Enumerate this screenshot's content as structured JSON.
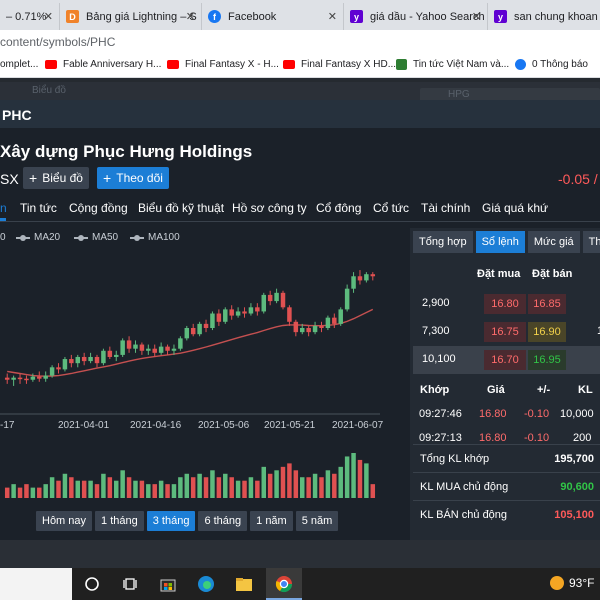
{
  "browser": {
    "tabs": [
      {
        "title": "– 0.71%",
        "icon": "page-icon",
        "color": "#e8eaed"
      },
      {
        "title": "Bảng giá Lightning – S",
        "icon": "vndirect-icon",
        "color": "#f0822a"
      },
      {
        "title": "Facebook",
        "icon": "facebook-icon",
        "color": "#1877f2"
      },
      {
        "title": "giá dầu - Yahoo Search",
        "icon": "yahoo-icon",
        "color": "#6001d2"
      },
      {
        "title": "san chung khoan vn",
        "icon": "yahoo-icon",
        "color": "#6001d2"
      }
    ],
    "url": "content/symbols/PHC",
    "bookmarks": [
      {
        "label": "omplet...",
        "icon": "youtube-icon",
        "color": "#ff0000"
      },
      {
        "label": "Fable Anniversary H...",
        "icon": "youtube-icon",
        "color": "#ff0000"
      },
      {
        "label": "Final Fantasy X - H...",
        "icon": "youtube-icon",
        "color": "#ff0000"
      },
      {
        "label": "Final Fantasy X HD...",
        "icon": "youtube-icon",
        "color": "#ff0000"
      },
      {
        "label": "Tin tức Việt Nam và...",
        "icon": "news-icon",
        "color": "#2e7d32"
      },
      {
        "label": "0 Thông báo",
        "icon": "facebook-icon",
        "color": "#1877f2"
      }
    ]
  },
  "background": {
    "nav_hint": "Biểu đồ",
    "search_hint": "HPG"
  },
  "modal": {
    "ticker": "PHC",
    "company": "Xây dựng Phục Hưng Holdings",
    "exchange": "SX",
    "chart_button": "Biểu đồ",
    "follow_button": "Theo dõi",
    "change": "-0.05 /",
    "tabs": [
      "n",
      "Tin tức",
      "Cộng đồng",
      "Biểu đồ kỹ thuật",
      "Hồ sơ công ty",
      "Cổ đông",
      "Cổ tức",
      "Tài chính",
      "Giá quá khứ"
    ],
    "legend": [
      "0",
      "MA20",
      "MA50",
      "MA100"
    ],
    "ranges": [
      "Hôm nay",
      "1 tháng",
      "3 tháng",
      "6 tháng",
      "1 năm",
      "5 năm"
    ],
    "active_range": "3 tháng"
  },
  "chart_data": {
    "type": "candlestick",
    "x_ticks": [
      "-17",
      "2021-04-01",
      "2021-04-16",
      "2021-05-06",
      "2021-05-21",
      "2021-06-07"
    ],
    "series": [
      {
        "name": "MA20",
        "type": "line",
        "color": "#c45050"
      },
      {
        "name": "volume",
        "type": "bar"
      }
    ],
    "up_color": "#5dbb7e",
    "down_color": "#e05151",
    "candles": [
      {
        "o": 11.9,
        "c": 11.8,
        "h": 12.1,
        "l": 11.6,
        "v": 3
      },
      {
        "o": 11.8,
        "c": 11.9,
        "h": 12.0,
        "l": 11.5,
        "v": 4
      },
      {
        "o": 11.9,
        "c": 11.85,
        "h": 12.1,
        "l": 11.6,
        "v": 3
      },
      {
        "o": 11.85,
        "c": 11.8,
        "h": 12.0,
        "l": 11.6,
        "v": 4
      },
      {
        "o": 11.8,
        "c": 11.95,
        "h": 12.1,
        "l": 11.7,
        "v": 3
      },
      {
        "o": 11.95,
        "c": 11.85,
        "h": 12.2,
        "l": 11.7,
        "v": 3
      },
      {
        "o": 11.85,
        "c": 12.0,
        "h": 12.2,
        "l": 11.7,
        "v": 4
      },
      {
        "o": 12.0,
        "c": 12.4,
        "h": 12.5,
        "l": 11.9,
        "v": 6
      },
      {
        "o": 12.4,
        "c": 12.3,
        "h": 12.6,
        "l": 12.1,
        "v": 5
      },
      {
        "o": 12.3,
        "c": 12.8,
        "h": 12.9,
        "l": 12.2,
        "v": 7
      },
      {
        "o": 12.8,
        "c": 12.6,
        "h": 13.0,
        "l": 12.4,
        "v": 6
      },
      {
        "o": 12.6,
        "c": 12.9,
        "h": 13.0,
        "l": 12.4,
        "v": 5
      },
      {
        "o": 12.9,
        "c": 12.7,
        "h": 13.1,
        "l": 12.5,
        "v": 5
      },
      {
        "o": 12.7,
        "c": 12.9,
        "h": 13.1,
        "l": 12.6,
        "v": 5
      },
      {
        "o": 12.9,
        "c": 12.6,
        "h": 13.0,
        "l": 12.4,
        "v": 4
      },
      {
        "o": 12.6,
        "c": 13.2,
        "h": 13.3,
        "l": 12.5,
        "v": 7
      },
      {
        "o": 13.2,
        "c": 12.9,
        "h": 13.4,
        "l": 12.8,
        "v": 6
      },
      {
        "o": 12.9,
        "c": 13.0,
        "h": 13.2,
        "l": 12.7,
        "v": 5
      },
      {
        "o": 13.0,
        "c": 13.7,
        "h": 13.8,
        "l": 12.9,
        "v": 8
      },
      {
        "o": 13.7,
        "c": 13.3,
        "h": 13.9,
        "l": 13.1,
        "v": 6
      },
      {
        "o": 13.3,
        "c": 13.5,
        "h": 13.7,
        "l": 13.1,
        "v": 5
      },
      {
        "o": 13.5,
        "c": 13.2,
        "h": 13.6,
        "l": 13.0,
        "v": 5
      },
      {
        "o": 13.2,
        "c": 13.3,
        "h": 13.5,
        "l": 13.0,
        "v": 4
      },
      {
        "o": 13.3,
        "c": 13.1,
        "h": 13.5,
        "l": 12.9,
        "v": 4
      },
      {
        "o": 13.1,
        "c": 13.4,
        "h": 13.6,
        "l": 13.0,
        "v": 5
      },
      {
        "o": 13.4,
        "c": 13.2,
        "h": 13.5,
        "l": 13.0,
        "v": 4
      },
      {
        "o": 13.2,
        "c": 13.3,
        "h": 13.5,
        "l": 13.0,
        "v": 4
      },
      {
        "o": 13.3,
        "c": 13.8,
        "h": 13.9,
        "l": 13.2,
        "v": 6
      },
      {
        "o": 13.8,
        "c": 14.3,
        "h": 14.4,
        "l": 13.7,
        "v": 7
      },
      {
        "o": 14.3,
        "c": 14.0,
        "h": 14.5,
        "l": 13.9,
        "v": 6
      },
      {
        "o": 14.0,
        "c": 14.5,
        "h": 14.6,
        "l": 13.9,
        "v": 7
      },
      {
        "o": 14.5,
        "c": 14.3,
        "h": 14.7,
        "l": 14.1,
        "v": 6
      },
      {
        "o": 14.3,
        "c": 15.0,
        "h": 15.1,
        "l": 14.2,
        "v": 8
      },
      {
        "o": 15.0,
        "c": 14.6,
        "h": 15.2,
        "l": 14.4,
        "v": 6
      },
      {
        "o": 14.6,
        "c": 15.2,
        "h": 15.3,
        "l": 14.5,
        "v": 7
      },
      {
        "o": 15.2,
        "c": 14.9,
        "h": 15.4,
        "l": 14.7,
        "v": 6
      },
      {
        "o": 14.9,
        "c": 15.1,
        "h": 15.3,
        "l": 14.8,
        "v": 5
      },
      {
        "o": 15.1,
        "c": 15.0,
        "h": 15.3,
        "l": 14.8,
        "v": 5
      },
      {
        "o": 15.0,
        "c": 15.3,
        "h": 15.5,
        "l": 14.9,
        "v": 6
      },
      {
        "o": 15.3,
        "c": 15.1,
        "h": 15.5,
        "l": 14.9,
        "v": 5
      },
      {
        "o": 15.1,
        "c": 15.9,
        "h": 16.0,
        "l": 15.0,
        "v": 9
      },
      {
        "o": 15.9,
        "c": 15.6,
        "h": 16.1,
        "l": 15.4,
        "v": 7
      },
      {
        "o": 15.6,
        "c": 16.0,
        "h": 16.2,
        "l": 15.5,
        "v": 8
      },
      {
        "o": 16.0,
        "c": 15.3,
        "h": 16.1,
        "l": 15.2,
        "v": 9
      },
      {
        "o": 15.3,
        "c": 14.6,
        "h": 15.4,
        "l": 14.4,
        "v": 10
      },
      {
        "o": 14.6,
        "c": 14.1,
        "h": 14.7,
        "l": 13.9,
        "v": 8
      },
      {
        "o": 14.1,
        "c": 14.3,
        "h": 14.5,
        "l": 14.0,
        "v": 6
      },
      {
        "o": 14.3,
        "c": 14.1,
        "h": 14.4,
        "l": 13.9,
        "v": 6
      },
      {
        "o": 14.1,
        "c": 14.4,
        "h": 14.6,
        "l": 14.0,
        "v": 7
      },
      {
        "o": 14.4,
        "c": 14.3,
        "h": 14.6,
        "l": 14.1,
        "v": 6
      },
      {
        "o": 14.3,
        "c": 14.8,
        "h": 14.9,
        "l": 14.2,
        "v": 8
      },
      {
        "o": 14.8,
        "c": 14.5,
        "h": 15.0,
        "l": 14.3,
        "v": 7
      },
      {
        "o": 14.5,
        "c": 15.2,
        "h": 15.3,
        "l": 14.4,
        "v": 9
      },
      {
        "o": 15.2,
        "c": 16.2,
        "h": 16.4,
        "l": 15.1,
        "v": 12
      },
      {
        "o": 16.2,
        "c": 16.8,
        "h": 17.0,
        "l": 16.0,
        "v": 13
      },
      {
        "o": 16.8,
        "c": 16.6,
        "h": 17.1,
        "l": 16.4,
        "v": 11
      },
      {
        "o": 16.6,
        "c": 16.9,
        "h": 17.0,
        "l": 16.5,
        "v": 10
      },
      {
        "o": 16.9,
        "c": 16.8,
        "h": 17.0,
        "l": 16.6,
        "v": 4
      }
    ],
    "ma20": [
      12.2,
      12.15,
      12.1,
      12.05,
      12.0,
      11.98,
      11.97,
      11.98,
      12.0,
      12.05,
      12.1,
      12.17,
      12.23,
      12.3,
      12.36,
      12.42,
      12.48,
      12.55,
      12.63,
      12.7,
      12.77,
      12.83,
      12.88,
      12.92,
      12.96,
      13.0,
      13.04,
      13.08,
      13.15,
      13.22,
      13.3,
      13.38,
      13.47,
      13.56,
      13.65,
      13.74,
      13.83,
      13.92,
      14.0,
      14.08,
      14.18,
      14.27,
      14.36,
      14.42,
      14.45,
      14.45,
      14.44,
      14.42,
      14.41,
      14.41,
      14.43,
      14.46,
      14.52,
      14.62,
      14.75,
      14.9,
      15.05,
      15.2
    ]
  },
  "order_book": {
    "tabs": [
      "Tổng hợp",
      "Sổ lệnh",
      "Mức giá",
      "Th"
    ],
    "active_tab": "Sổ lệnh",
    "headers": {
      "bid": "Đặt mua",
      "ask": "Đặt bán"
    },
    "rows": [
      {
        "volume": "2,900",
        "bid": "16.80",
        "ask": "16.85",
        "bid_color": "#ff6b6b",
        "ask_color": "#ff6b6b",
        "ask_bg": "#4a2a30"
      },
      {
        "volume": "7,300",
        "bid": "16.75",
        "ask": "16.90",
        "bid_color": "#ff6b6b",
        "ask_color": "#f3d24a",
        "ask_bg": "#4a4528"
      },
      {
        "volume": "10,100",
        "bid": "16.70",
        "ask": "16.95",
        "bid_color": "#ff6b6b",
        "ask_color": "#31c447",
        "ask_bg": "#2a3b2c"
      }
    ],
    "trades_headers": [
      "Khớp",
      "Giá",
      "+/-",
      "KL"
    ],
    "trades": [
      {
        "time": "09:27:46",
        "price": "16.80",
        "change": "-0.10",
        "volume": "10,000"
      },
      {
        "time": "09:27:13",
        "price": "16.80",
        "change": "-0.10",
        "volume": "200"
      }
    ],
    "summary": [
      {
        "label": "Tổng KL khớp",
        "value": "195,700",
        "color": "#ffffff"
      },
      {
        "label": "KL MUA chủ động",
        "value": "90,600",
        "color": "#31c447"
      },
      {
        "label": "KL BÁN chủ động",
        "value": "105,100",
        "color": "#ff5a5a"
      }
    ]
  },
  "taskbar": {
    "apps": [
      "search-icon",
      "task-view-icon",
      "store-icon",
      "edge-icon",
      "file-explorer-icon",
      "chrome-icon"
    ],
    "temperature": "93°F"
  }
}
